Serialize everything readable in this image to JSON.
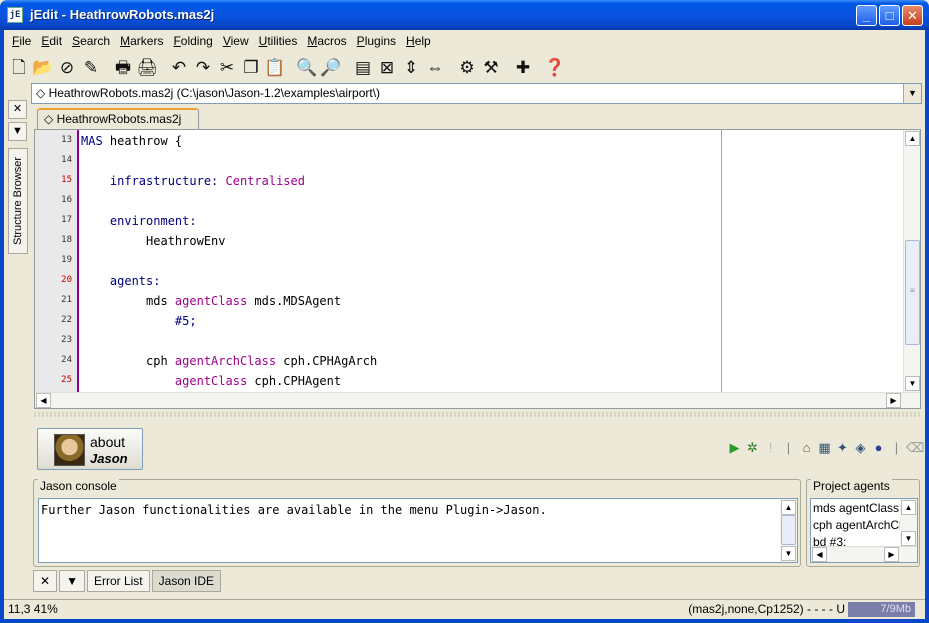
{
  "window": {
    "title": "jEdit - HeathrowRobots.mas2j",
    "app_icon": "jE"
  },
  "menu": [
    "File",
    "Edit",
    "Search",
    "Markers",
    "Folding",
    "View",
    "Utilities",
    "Macros",
    "Plugins",
    "Help"
  ],
  "buffer_selector": {
    "value": "HeathrowRobots.mas2j (C:\\jason\\Jason-1.2\\examples\\airport\\)"
  },
  "editor_tab": {
    "label": "HeathrowRobots.mas2j"
  },
  "left_dock": {
    "structure_browser": "Structure Browser"
  },
  "editor": {
    "line_numbers": [
      "13",
      "14",
      "15",
      "16",
      "17",
      "18",
      "19",
      "20",
      "21",
      "22",
      "23",
      "24",
      "25"
    ],
    "lines": [
      [
        {
          "t": "MAS",
          "c": "kw"
        },
        {
          "t": " heathrow {",
          "c": ""
        }
      ],
      [],
      [
        {
          "t": "    infrastructure: ",
          "c": "kw"
        },
        {
          "t": "Centralised",
          "c": "kw2"
        }
      ],
      [],
      [
        {
          "t": "    environment:",
          "c": "kw"
        }
      ],
      [
        {
          "t": "         HeathrowEnv",
          "c": ""
        }
      ],
      [],
      [
        {
          "t": "    agents:",
          "c": "kw"
        }
      ],
      [
        {
          "t": "         mds ",
          "c": ""
        },
        {
          "t": "agentClass",
          "c": "kw2"
        },
        {
          "t": " mds.MDSAgent",
          "c": ""
        }
      ],
      [
        {
          "t": "             #5;",
          "c": "kw"
        }
      ],
      [],
      [
        {
          "t": "         cph ",
          "c": ""
        },
        {
          "t": "agentArchClass",
          "c": "kw2"
        },
        {
          "t": " cph.CPHAgArch",
          "c": ""
        }
      ],
      [
        {
          "t": "             ",
          "c": ""
        },
        {
          "t": "agentClass",
          "c": "kw2"
        },
        {
          "t": " cph.CPHAgent",
          "c": ""
        }
      ]
    ]
  },
  "about_button": {
    "line1": "about",
    "line2": "Jason"
  },
  "console": {
    "title": "Jason console",
    "text": "Further Jason functionalities are available in the menu Plugin->Jason."
  },
  "project_agents": {
    "title": "Project agents",
    "items": [
      "mds agentClass",
      "cph agentArchCl",
      "bd #3;"
    ]
  },
  "bottom_dock": {
    "error_list": "Error List",
    "jason_ide": "Jason IDE"
  },
  "status": {
    "left": "11,3 41%",
    "right": "(mas2j,none,Cp1252) - - - - U",
    "memory": "7/9Mb"
  },
  "colors": {
    "titlebar": "#0a54e0",
    "keyword": "#000080",
    "keyword2": "#a0008a",
    "gutter_marker": "#8b008b"
  }
}
